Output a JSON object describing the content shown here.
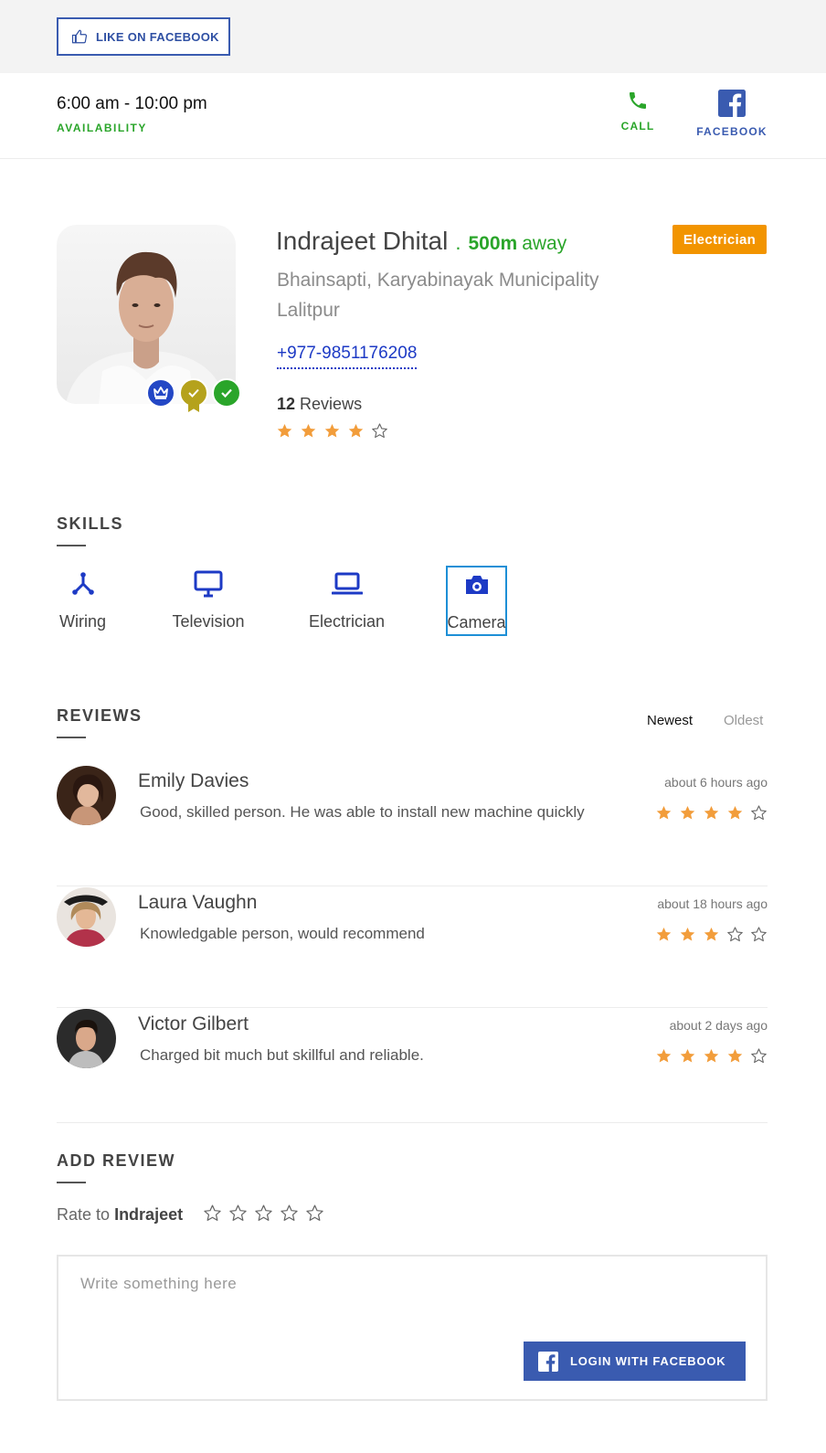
{
  "header": {
    "like_label": "LIKE ON FACEBOOK"
  },
  "info": {
    "hours": "6:00 am - 10:00 pm",
    "availability_label": "AVAILABILITY",
    "call_label": "CALL",
    "facebook_label": "FACEBOOK",
    "call_icon": "phone-icon",
    "facebook_icon": "facebook-icon"
  },
  "profile": {
    "name": "Indrajeet Dhital",
    "separator": ".",
    "distance": "500m",
    "away_label": "away",
    "category": "Electrician",
    "address_line1": "Bhainsapti, Karyabinayak Municipality",
    "address_line2": "Lalitpur",
    "phone": "+977-9851176208",
    "review_count": "12",
    "reviews_label": "Reviews",
    "rating": 4,
    "rating_max": 5,
    "badges": [
      "crown-badge-icon",
      "medal-badge-icon",
      "verified-badge-icon"
    ]
  },
  "skills": {
    "title": "SKILLS",
    "items": [
      {
        "label": "Wiring",
        "icon": "wiring-icon"
      },
      {
        "label": "Television",
        "icon": "monitor-icon"
      },
      {
        "label": "Electrician",
        "icon": "laptop-icon"
      },
      {
        "label": "Camera",
        "icon": "camera-icon",
        "selected": true
      }
    ]
  },
  "reviews": {
    "title": "REVIEWS",
    "sort_newest": "Newest",
    "sort_oldest": "Oldest",
    "items": [
      {
        "name": "Emily Davies",
        "text": "Good, skilled person. He was able to install new machine quickly",
        "time": "about 6 hours ago",
        "rating": 4
      },
      {
        "name": "Laura Vaughn",
        "text": "Knowledgable person, would recommend",
        "time": "about 18 hours ago",
        "rating": 3
      },
      {
        "name": "Victor Gilbert",
        "text": "Charged bit much but skillful and reliable.",
        "time": "about 2 days ago",
        "rating": 4
      }
    ]
  },
  "add_review": {
    "title": "ADD REVIEW",
    "rate_prefix": "Rate to",
    "rate_name": "Indrajeet",
    "rating": 0,
    "placeholder": "Write something here",
    "login_label": "LOGIN WITH FACEBOOK"
  },
  "colors": {
    "accent_green": "#2aa52a",
    "facebook_blue": "#3a5bb0",
    "link_blue": "#1d3ac5",
    "category_orange": "#f29400",
    "star_orange": "#f29d3b",
    "skill_icon_blue": "#1d3ac5"
  }
}
